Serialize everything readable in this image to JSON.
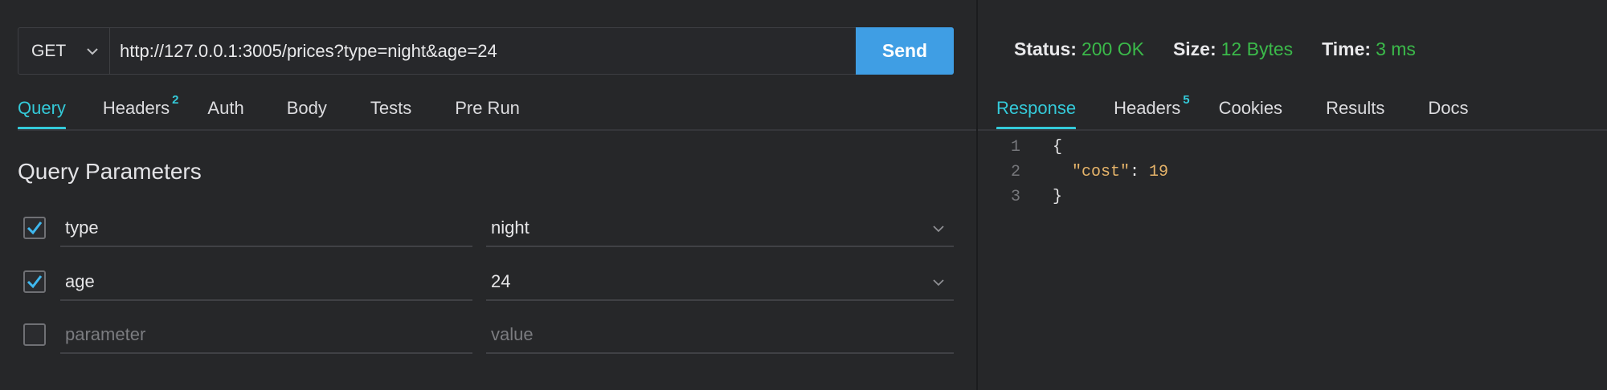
{
  "request": {
    "method": "GET",
    "url": "http://127.0.0.1:3005/prices?type=night&age=24",
    "send_label": "Send"
  },
  "request_tabs": [
    {
      "label": "Query",
      "badge": "",
      "active": true
    },
    {
      "label": "Headers",
      "badge": "2",
      "active": false
    },
    {
      "label": "Auth",
      "badge": "",
      "active": false
    },
    {
      "label": "Body",
      "badge": "",
      "active": false
    },
    {
      "label": "Tests",
      "badge": "",
      "active": false
    },
    {
      "label": "Pre Run",
      "badge": "",
      "active": false
    }
  ],
  "query": {
    "title": "Query Parameters",
    "params": [
      {
        "checked": true,
        "key": "type",
        "value": "night"
      },
      {
        "checked": true,
        "key": "age",
        "value": "24"
      }
    ],
    "new_param": {
      "checked": false,
      "key_placeholder": "parameter",
      "value_placeholder": "value"
    }
  },
  "response": {
    "status_label": "Status:",
    "status_value": "200 OK",
    "size_label": "Size:",
    "size_value": "12 Bytes",
    "time_label": "Time:",
    "time_value": "3 ms"
  },
  "response_tabs": [
    {
      "label": "Response",
      "badge": "",
      "active": true
    },
    {
      "label": "Headers",
      "badge": "5",
      "active": false
    },
    {
      "label": "Cookies",
      "badge": "",
      "active": false
    },
    {
      "label": "Results",
      "badge": "",
      "active": false
    },
    {
      "label": "Docs",
      "badge": "",
      "active": false
    }
  ],
  "body_lines": [
    {
      "no": "1",
      "open": "{"
    },
    {
      "no": "2",
      "key": "\"cost\"",
      "sep": ": ",
      "val": "19"
    },
    {
      "no": "3",
      "close": "}"
    }
  ],
  "colors": {
    "accent": "#34cad9",
    "send_button": "#3f9ee4",
    "status_ok": "#3bba4a",
    "json_token": "#e6b46a",
    "background": "#262729"
  },
  "icons": {
    "method_dropdown": "chevron-down-icon",
    "checkbox_checked": "checkmark-icon",
    "value_dropdown": "chevron-down-icon"
  }
}
